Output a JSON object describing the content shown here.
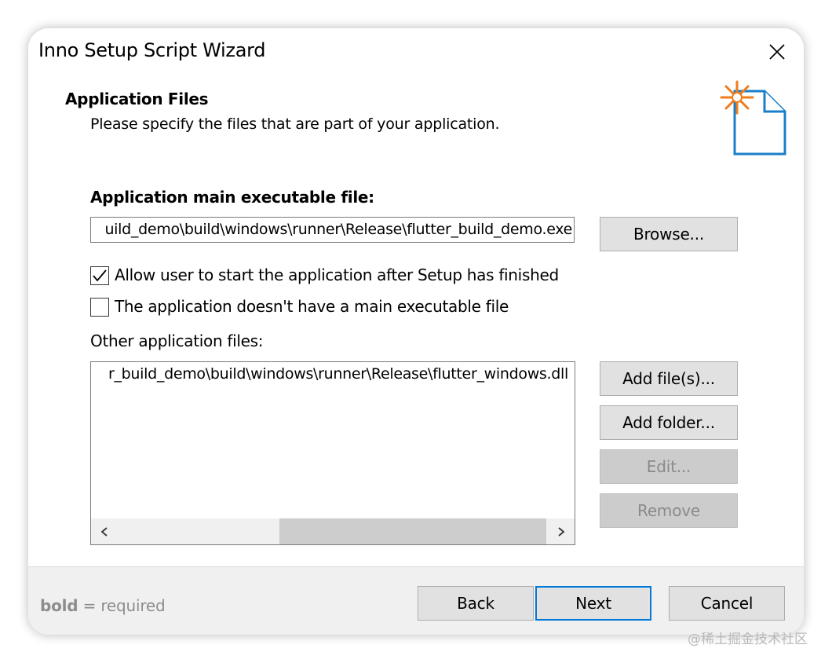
{
  "window": {
    "title": "Inno Setup Script Wizard",
    "close_icon": "close-icon"
  },
  "header": {
    "title": "Application Files",
    "subtitle": "Please specify the files that are part of your application.",
    "icon": "new-file-sparkle-icon"
  },
  "main_exe": {
    "label": "Application main executable file:",
    "value": "uild_demo\\build\\windows\\runner\\Release\\flutter_build_demo.exe",
    "browse_label": "Browse..."
  },
  "options": [
    {
      "label": "Allow user to start the application after Setup has finished",
      "checked": true
    },
    {
      "label": "The application doesn't have a main executable file",
      "checked": false
    }
  ],
  "other_files": {
    "label": "Other application files:",
    "items": [
      "r_build_demo\\build\\windows\\runner\\Release\\flutter_windows.dll"
    ],
    "add_files_label": "Add file(s)...",
    "add_folder_label": "Add folder...",
    "edit_label": "Edit...",
    "remove_label": "Remove",
    "scroll_left_icon": "chevron-left-icon",
    "scroll_right_icon": "chevron-right-icon"
  },
  "footer": {
    "hint_bold": "bold",
    "hint_rest": "= required",
    "back_label": "Back",
    "next_label": "Next",
    "cancel_label": "Cancel"
  },
  "watermark": "@稀土掘金技术社区",
  "colors": {
    "accent": "#0078d7",
    "icon_blue": "#1a7fc8",
    "sparkle_orange": "#f07d1a",
    "footer_bg": "#f0f0f0",
    "button_bg": "#e1e1e1",
    "disabled_button_bg": "#cccccc"
  }
}
